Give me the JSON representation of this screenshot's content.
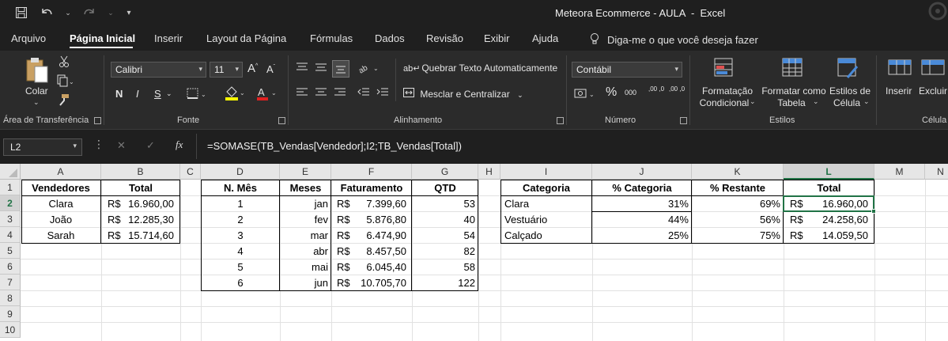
{
  "window": {
    "title": "Meteora Ecommerce - AULA  -  Excel"
  },
  "qat": {
    "save_icon": "save-icon",
    "undo_icon": "undo-icon",
    "redo_icon": "redo-icon",
    "customize_icon": "customize-qat-icon"
  },
  "menu": {
    "tabs": [
      "Arquivo",
      "Página Inicial",
      "Inserir",
      "Layout da Página",
      "Fórmulas",
      "Dados",
      "Revisão",
      "Exibir",
      "Ajuda"
    ],
    "active": "Página Inicial",
    "tell_me": "Diga-me o que você deseja fazer"
  },
  "ribbon": {
    "clipboard": {
      "paste": "Colar",
      "label": "Área de Transferência"
    },
    "font": {
      "name": "Calibri",
      "size": "11",
      "bold": "N",
      "italic": "I",
      "underline": "S",
      "label": "Fonte"
    },
    "alignment": {
      "wrap": "Quebrar Texto Automaticamente",
      "merge": "Mesclar e Centralizar",
      "label": "Alinhamento"
    },
    "number": {
      "format": "Contábil",
      "percent": "%",
      "thousands": "000",
      "inc_decimal": ",00 ,0",
      "dec_decimal": ",00 ,0",
      "label": "Número"
    },
    "styles": {
      "conditional_1": "Formatação",
      "conditional_2": "Condicional",
      "table_1": "Formatar como",
      "table_2": "Tabela",
      "cell_1": "Estilos de",
      "cell_2": "Célula",
      "label": "Estilos"
    },
    "cells": {
      "insert": "Inserir",
      "delete": "Excluir",
      "label": "Célula"
    }
  },
  "formula_bar": {
    "name_box": "L2",
    "cancel": "✕",
    "enter": "✓",
    "fx": "fx",
    "formula": "=SOMASE(TB_Vendas[Vendedor];I2;TB_Vendas[Total])"
  },
  "sheet": {
    "columns": [
      "A",
      "B",
      "C",
      "D",
      "E",
      "F",
      "G",
      "H",
      "I",
      "J",
      "K",
      "L",
      "M",
      "N"
    ],
    "rows": [
      "1",
      "2",
      "3",
      "4",
      "5",
      "6",
      "7",
      "8",
      "9",
      "10"
    ],
    "selected_cell": "L2",
    "table1": {
      "headers": [
        "Vendedores",
        "Total"
      ],
      "rows": [
        {
          "name": "Clara",
          "cur": "R$",
          "val": "16.960,00"
        },
        {
          "name": "João",
          "cur": "R$",
          "val": "12.285,30"
        },
        {
          "name": "Sarah",
          "cur": "R$",
          "val": "15.714,60"
        }
      ]
    },
    "table2": {
      "headers": [
        "N. Mês",
        "Meses",
        "Faturamento",
        "QTD"
      ],
      "rows": [
        {
          "n": "1",
          "mes": "jan",
          "cur": "R$",
          "fat": "7.399,60",
          "qtd": "53"
        },
        {
          "n": "2",
          "mes": "fev",
          "cur": "R$",
          "fat": "5.876,80",
          "qtd": "40"
        },
        {
          "n": "3",
          "mes": "mar",
          "cur": "R$",
          "fat": "6.474,90",
          "qtd": "54"
        },
        {
          "n": "4",
          "mes": "abr",
          "cur": "R$",
          "fat": "8.457,50",
          "qtd": "82"
        },
        {
          "n": "5",
          "mes": "mai",
          "cur": "R$",
          "fat": "6.045,40",
          "qtd": "58"
        },
        {
          "n": "6",
          "mes": "jun",
          "cur": "R$",
          "fat": "10.705,70",
          "qtd": "122"
        }
      ]
    },
    "table3": {
      "headers": [
        "Categoria",
        "% Categoria",
        "% Restante",
        "Total"
      ],
      "rows": [
        {
          "cat": "Clara",
          "pc": "31%",
          "pr": "69%",
          "cur": "R$",
          "tot": "16.960,00"
        },
        {
          "cat": "Vestuário",
          "pc": "44%",
          "pr": "56%",
          "cur": "R$",
          "tot": "24.258,60"
        },
        {
          "cat": "Calçado",
          "pc": "25%",
          "pr": "75%",
          "cur": "R$",
          "tot": "14.059,50"
        }
      ]
    }
  },
  "colors": {
    "accent": "#217346",
    "ribbon_bg": "#2b2b2b",
    "chrome_bg": "#1f1f1f"
  }
}
